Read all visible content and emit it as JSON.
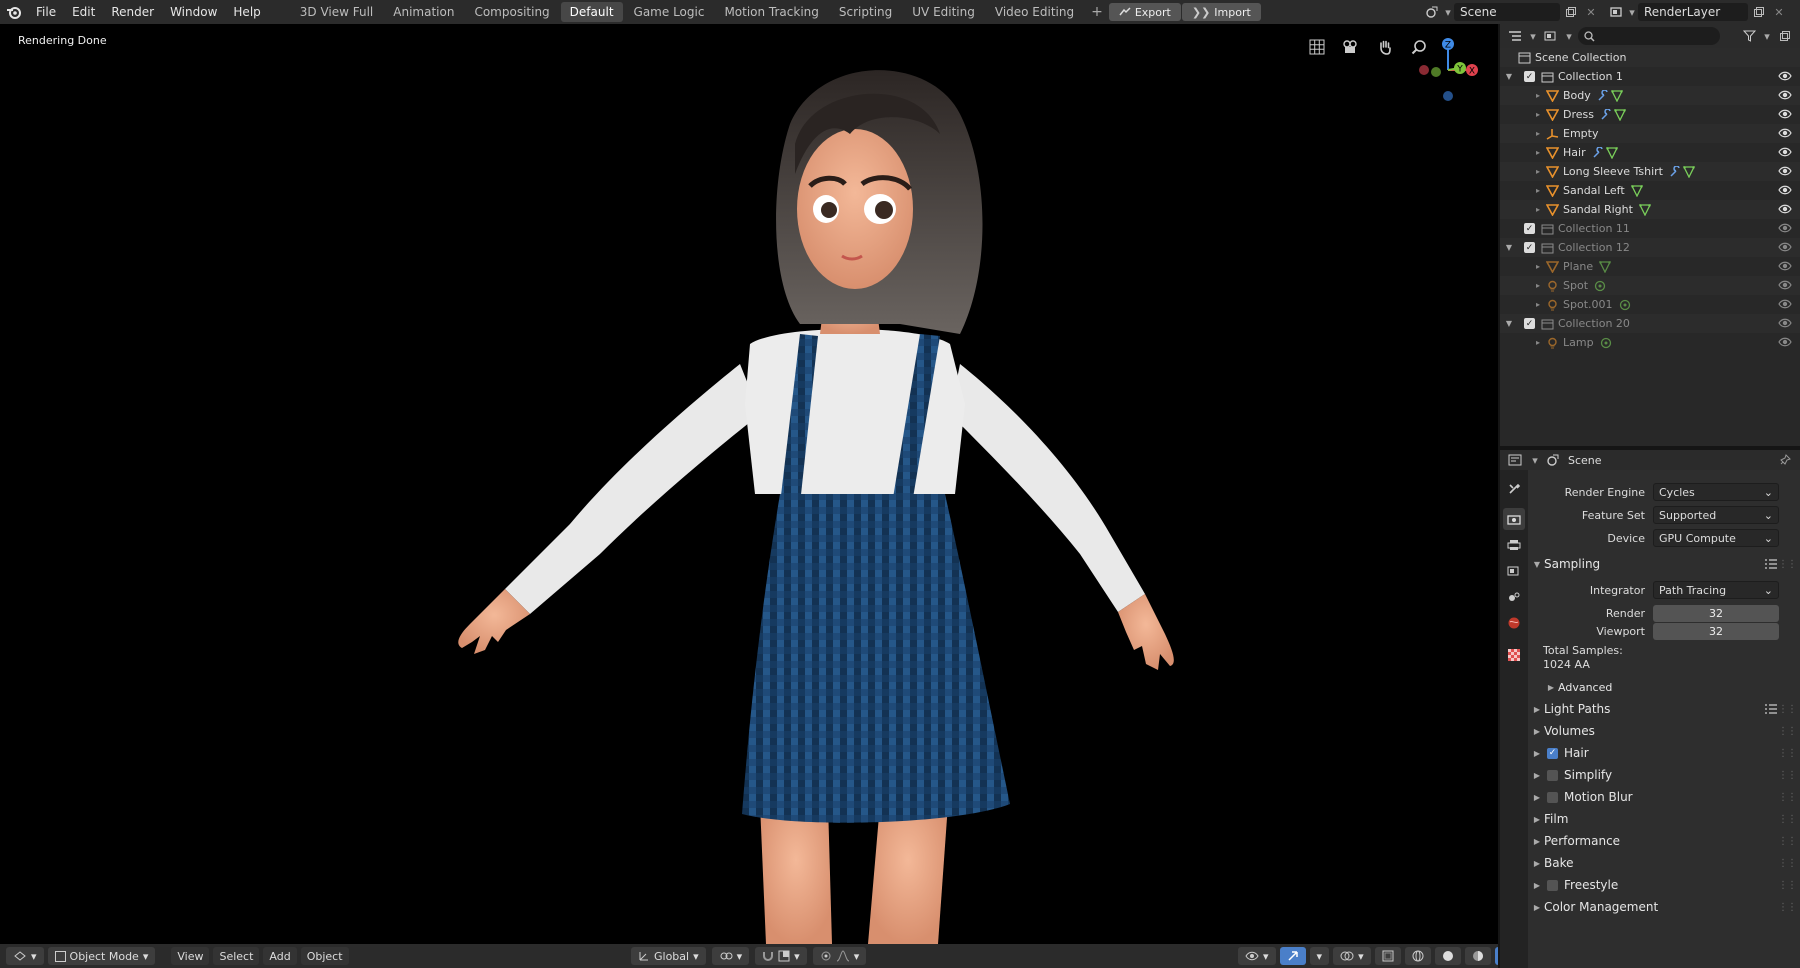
{
  "menu": [
    "File",
    "Edit",
    "Render",
    "Window",
    "Help"
  ],
  "workspaces": {
    "tabs": [
      "3D View Full",
      "Animation",
      "Compositing",
      "Default",
      "Game Logic",
      "Motion Tracking",
      "Scripting",
      "UV Editing",
      "Video Editing"
    ],
    "active": "Default",
    "add": "+"
  },
  "top_actions": {
    "export": "Export",
    "import": "Import"
  },
  "scene_field": "Scene",
  "render_layer_field": "RenderLayer",
  "viewport": {
    "status": "Rendering Done"
  },
  "gizmo": {
    "z": "Z",
    "y": "Y",
    "x": "X"
  },
  "bottombar": {
    "mode": "Object Mode",
    "menus": [
      "View",
      "Select",
      "Add",
      "Object"
    ],
    "orientation": "Global"
  },
  "outliner": {
    "root": "Scene Collection",
    "rows": [
      {
        "label": "Collection 1",
        "kind": "collection",
        "indent": 1
      },
      {
        "label": "Body",
        "kind": "mesh",
        "indent": 2,
        "mods": [
          "wrench",
          "tri"
        ]
      },
      {
        "label": "Dress",
        "kind": "mesh",
        "indent": 2,
        "mods": [
          "wrench",
          "tri"
        ]
      },
      {
        "label": "Empty",
        "kind": "empty",
        "indent": 2
      },
      {
        "label": "Hair",
        "kind": "mesh",
        "indent": 2,
        "mods": [
          "wrench",
          "tri"
        ]
      },
      {
        "label": "Long Sleeve Tshirt",
        "kind": "mesh",
        "indent": 2,
        "mods": [
          "wrench",
          "tri"
        ]
      },
      {
        "label": "Sandal Left",
        "kind": "mesh",
        "indent": 2,
        "mods": [
          "tri"
        ]
      },
      {
        "label": "Sandal Right",
        "kind": "mesh",
        "indent": 2,
        "mods": [
          "tri"
        ]
      },
      {
        "label": "Collection 11",
        "kind": "collection",
        "indent": 1,
        "dim": true
      },
      {
        "label": "Collection 12",
        "kind": "collection",
        "indent": 1,
        "dim": true
      },
      {
        "label": "Plane",
        "kind": "mesh",
        "indent": 2,
        "dim": true,
        "mods": [
          "tri"
        ]
      },
      {
        "label": "Spot",
        "kind": "light",
        "indent": 2,
        "dim": true,
        "mods": [
          "light"
        ]
      },
      {
        "label": "Spot.001",
        "kind": "light",
        "indent": 2,
        "dim": true,
        "mods": [
          "light"
        ]
      },
      {
        "label": "Collection 20",
        "kind": "collection",
        "indent": 1,
        "dim": true
      },
      {
        "label": "Lamp",
        "kind": "light",
        "indent": 2,
        "dim": true,
        "mods": [
          "light"
        ]
      }
    ]
  },
  "properties": {
    "context": "Scene",
    "render_engine_label": "Render Engine",
    "render_engine": "Cycles",
    "feature_set_label": "Feature Set",
    "feature_set": "Supported",
    "device_label": "Device",
    "device": "GPU Compute",
    "sampling": {
      "title": "Sampling",
      "integrator_label": "Integrator",
      "integrator": "Path Tracing",
      "render_label": "Render",
      "render": "32",
      "viewport_label": "Viewport",
      "viewport": "32",
      "total_label": "Total Samples:",
      "total_value": "1024 AA",
      "advanced": "Advanced"
    },
    "panels": [
      {
        "label": "Light Paths"
      },
      {
        "label": "Volumes"
      },
      {
        "label": "Hair",
        "checkbox": true,
        "checked": true
      },
      {
        "label": "Simplify",
        "checkbox": true,
        "checked": false
      },
      {
        "label": "Motion Blur",
        "checkbox": true,
        "checked": false
      },
      {
        "label": "Film"
      },
      {
        "label": "Performance"
      },
      {
        "label": "Bake"
      },
      {
        "label": "Freestyle",
        "checkbox": true,
        "checked": false
      },
      {
        "label": "Color Management"
      }
    ]
  },
  "colors": {
    "accent_blue": "#4a7fc9",
    "mesh_orange": "#e8912c",
    "modifier_blue": "#6aa0e6",
    "data_green": "#7acf5a",
    "gizmo_x": "#e0424e",
    "gizmo_y": "#7fc43a",
    "gizmo_z": "#3f8ae6"
  }
}
